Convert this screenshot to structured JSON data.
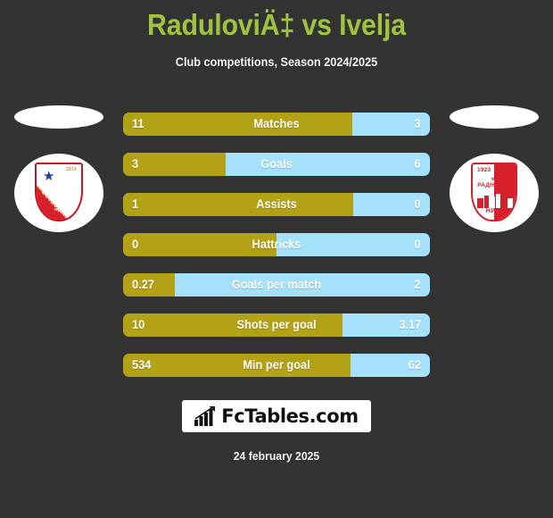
{
  "header": {
    "title": "RaduloviÄ‡ vs Ivelja",
    "subtitle": "Club competitions, Season 2024/2025"
  },
  "teams": {
    "home": {
      "crest_name": "fk-vojvodina-novi-sad-crest",
      "year": "1914",
      "club_prefix": "ФК",
      "name": "ВОЈВОДИНА",
      "city": "НОВИ САД"
    },
    "away": {
      "crest_name": "fk-radnicki-nis-crest",
      "year": "1923",
      "club_prefix": "ФК",
      "name": "РАДНИЧКИ",
      "city": "НИШ"
    }
  },
  "colors": {
    "background": "#333333",
    "title": "#9fc33f",
    "home_bar": "#b3a116",
    "away_bar": "#a5e1fa",
    "text": "#ffffff"
  },
  "stats": [
    {
      "label": "Matches",
      "home": "11",
      "away": "3",
      "home_pct": 74.7
    },
    {
      "label": "Goals",
      "home": "3",
      "away": "6",
      "home_pct": 33.3
    },
    {
      "label": "Assists",
      "home": "1",
      "away": "0",
      "home_pct": 75.0
    },
    {
      "label": "Hattricks",
      "home": "0",
      "away": "0",
      "home_pct": 50.0
    },
    {
      "label": "Goals per match",
      "home": "0.27",
      "away": "2",
      "home_pct": 16.9
    },
    {
      "label": "Shots per goal",
      "home": "10",
      "away": "3.17",
      "home_pct": 71.5
    },
    {
      "label": "Min per goal",
      "home": "534",
      "away": "62",
      "home_pct": 74.0
    }
  ],
  "footer": {
    "logo_text": "FcTables.com",
    "logo_icon": "bar-chart-arrow-icon",
    "date": "24 february 2025"
  }
}
